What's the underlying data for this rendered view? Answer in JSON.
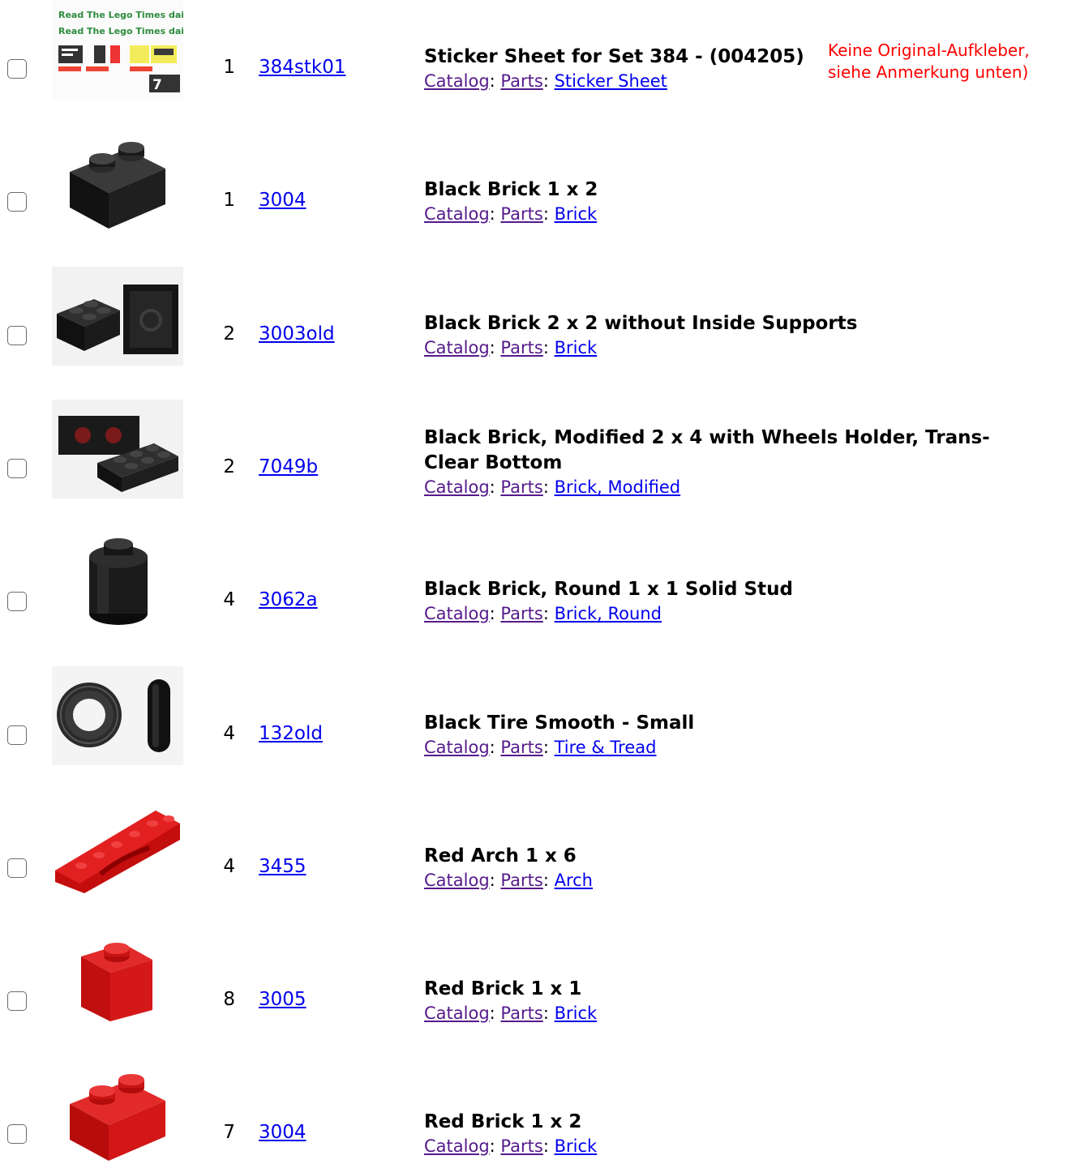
{
  "colors": {
    "link": "#0000ee",
    "visited": "#551a8b",
    "note": "#ff0000"
  },
  "items": [
    {
      "image_name": "sticker-sheet-image",
      "qty": "1",
      "number": "384stk01",
      "name_lines": [
        "Sticker Sheet for Set 384 - (004205)"
      ],
      "catalog": "Catalog",
      "parts": "Parts",
      "category": "Sticker Sheet",
      "note": "Keine Original-Aufkleber, siehe Anmerkung unten)",
      "thumb_text": {
        "banner": "Read The Lego Times daily",
        "sticker_7": "7"
      }
    },
    {
      "image_name": "black-brick-1x2-image",
      "qty": "1",
      "number": "3004",
      "name_lines": [
        "Black Brick 1 x 2"
      ],
      "catalog": "Catalog",
      "parts": "Parts",
      "category": "Brick"
    },
    {
      "image_name": "black-brick-2x2-image",
      "qty": "2",
      "number": "3003old",
      "name_lines": [
        "Black Brick 2 x 2 without Inside Supports"
      ],
      "catalog": "Catalog",
      "parts": "Parts",
      "category": "Brick"
    },
    {
      "image_name": "black-brick-modified-2x4-image",
      "qty": "2",
      "number": "7049b",
      "name_lines": [
        "Black Brick, Modified 2 x 4 with Wheels Holder, Trans-",
        "Clear Bottom"
      ],
      "catalog": "Catalog",
      "parts": "Parts",
      "category": "Brick, Modified"
    },
    {
      "image_name": "black-brick-round-image",
      "qty": "4",
      "number": "3062a",
      "name_lines": [
        "Black Brick, Round 1 x 1 Solid Stud"
      ],
      "catalog": "Catalog",
      "parts": "Parts",
      "category": "Brick, Round"
    },
    {
      "image_name": "black-tire-image",
      "qty": "4",
      "number": "132old",
      "name_lines": [
        "Black Tire Smooth - Small"
      ],
      "catalog": "Catalog",
      "parts": "Parts",
      "category": "Tire & Tread"
    },
    {
      "image_name": "red-arch-image",
      "qty": "4",
      "number": "3455",
      "name_lines": [
        "Red Arch 1 x 6"
      ],
      "catalog": "Catalog",
      "parts": "Parts",
      "category": "Arch"
    },
    {
      "image_name": "red-brick-1x1-image",
      "qty": "8",
      "number": "3005",
      "name_lines": [
        "Red Brick 1 x 1"
      ],
      "catalog": "Catalog",
      "parts": "Parts",
      "category": "Brick"
    },
    {
      "image_name": "red-brick-1x2-image",
      "qty": "7",
      "number": "3004",
      "name_lines": [
        "Red Brick 1 x 2"
      ],
      "catalog": "Catalog",
      "parts": "Parts",
      "category": "Brick"
    }
  ]
}
